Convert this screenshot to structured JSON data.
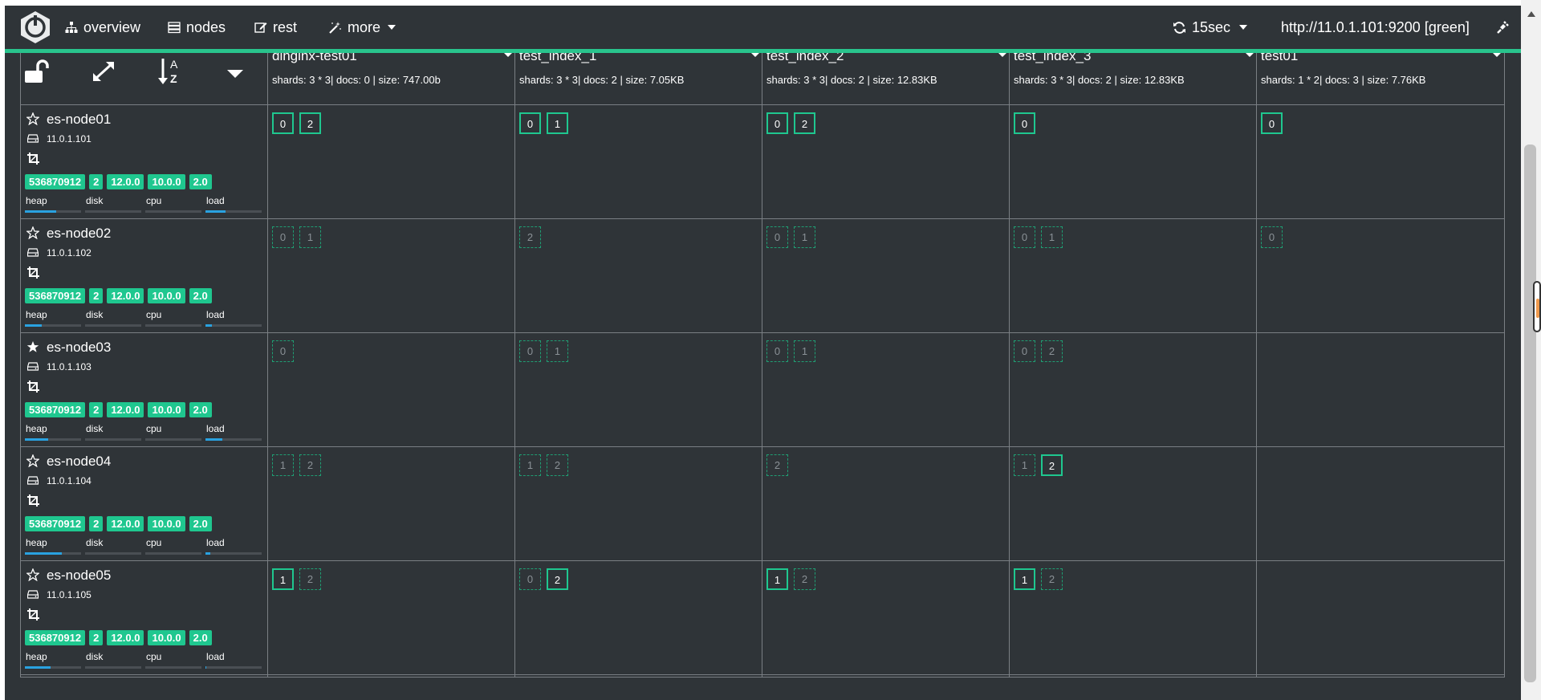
{
  "navbar": {
    "overview_label": "overview",
    "nodes_label": "nodes",
    "rest_label": "rest",
    "more_label": "more",
    "refresh_label": "15sec",
    "cluster_label": "http://11.0.1.101:9200 [green]"
  },
  "colors": {
    "accent": "#29c48d",
    "background": "#2f3438",
    "badge": "#1fc78f",
    "metric_fill": "#29a2e0"
  },
  "controls": [
    "unlock-icon",
    "expand-icon",
    "sort-alpha-icon",
    "caret-down-icon"
  ],
  "indices": [
    {
      "name": "dinginx-test01",
      "stats": "shards: 3 * 3| docs: 0 | size: 747.00b"
    },
    {
      "name": "test_index_1",
      "stats": "shards: 3 * 3| docs: 2 | size: 7.05KB"
    },
    {
      "name": "test_index_2",
      "stats": "shards: 3 * 3| docs: 2 | size: 12.83KB"
    },
    {
      "name": "test_index_3",
      "stats": "shards: 3 * 3| docs: 2 | size: 12.83KB"
    },
    {
      "name": "test01",
      "stats": "shards: 1 * 2| docs: 3 | size: 7.76KB"
    }
  ],
  "nodes": [
    {
      "name": "es-node01",
      "ip": "11.0.1.101",
      "master": false,
      "badges": [
        "536870912",
        "2",
        "12.0.0",
        "10.0.0",
        "2.0"
      ],
      "metrics": {
        "heap": 0.55,
        "disk": 0.0,
        "cpu": 0.0,
        "load": 0.35
      },
      "shards": [
        [
          {
            "n": "0",
            "p": true
          },
          {
            "n": "2",
            "p": true
          }
        ],
        [
          {
            "n": "0",
            "p": true
          },
          {
            "n": "1",
            "p": true
          }
        ],
        [
          {
            "n": "0",
            "p": true
          },
          {
            "n": "2",
            "p": true
          }
        ],
        [
          {
            "n": "0",
            "p": true
          }
        ],
        [
          {
            "n": "0",
            "p": true
          }
        ]
      ]
    },
    {
      "name": "es-node02",
      "ip": "11.0.1.102",
      "master": false,
      "badges": [
        "536870912",
        "2",
        "12.0.0",
        "10.0.0",
        "2.0"
      ],
      "metrics": {
        "heap": 0.3,
        "disk": 0.0,
        "cpu": 0.0,
        "load": 0.12
      },
      "shards": [
        [
          {
            "n": "0",
            "p": false
          },
          {
            "n": "1",
            "p": false
          }
        ],
        [
          {
            "n": "2",
            "p": false
          }
        ],
        [
          {
            "n": "0",
            "p": false
          },
          {
            "n": "1",
            "p": false
          }
        ],
        [
          {
            "n": "0",
            "p": false
          },
          {
            "n": "1",
            "p": false
          }
        ],
        [
          {
            "n": "0",
            "p": false
          }
        ]
      ]
    },
    {
      "name": "es-node03",
      "ip": "11.0.1.103",
      "master": true,
      "badges": [
        "536870912",
        "2",
        "12.0.0",
        "10.0.0",
        "2.0"
      ],
      "metrics": {
        "heap": 0.42,
        "disk": 0.0,
        "cpu": 0.0,
        "load": 0.3
      },
      "shards": [
        [
          {
            "n": "0",
            "p": false
          }
        ],
        [
          {
            "n": "0",
            "p": false
          },
          {
            "n": "1",
            "p": false
          }
        ],
        [
          {
            "n": "0",
            "p": false
          },
          {
            "n": "1",
            "p": false
          }
        ],
        [
          {
            "n": "0",
            "p": false
          },
          {
            "n": "2",
            "p": false
          }
        ],
        []
      ]
    },
    {
      "name": "es-node04",
      "ip": "11.0.1.104",
      "master": false,
      "badges": [
        "536870912",
        "2",
        "12.0.0",
        "10.0.0",
        "2.0"
      ],
      "metrics": {
        "heap": 0.65,
        "disk": 0.0,
        "cpu": 0.0,
        "load": 0.08
      },
      "shards": [
        [
          {
            "n": "1",
            "p": false
          },
          {
            "n": "2",
            "p": false
          }
        ],
        [
          {
            "n": "1",
            "p": false
          },
          {
            "n": "2",
            "p": false
          }
        ],
        [
          {
            "n": "2",
            "p": false
          }
        ],
        [
          {
            "n": "1",
            "p": false
          },
          {
            "n": "2",
            "p": true
          }
        ],
        []
      ]
    },
    {
      "name": "es-node05",
      "ip": "11.0.1.105",
      "master": false,
      "badges": [
        "536870912",
        "2",
        "12.0.0",
        "10.0.0",
        "2.0"
      ],
      "metrics": {
        "heap": 0.45,
        "disk": 0.0,
        "cpu": 0.0,
        "load": 0.02
      },
      "shards": [
        [
          {
            "n": "1",
            "p": true
          },
          {
            "n": "2",
            "p": false
          }
        ],
        [
          {
            "n": "0",
            "p": false
          },
          {
            "n": "2",
            "p": true
          }
        ],
        [
          {
            "n": "1",
            "p": true
          },
          {
            "n": "2",
            "p": false
          }
        ],
        [
          {
            "n": "1",
            "p": true
          },
          {
            "n": "2",
            "p": false
          }
        ],
        []
      ]
    }
  ],
  "metric_labels": [
    "heap",
    "disk",
    "cpu",
    "load"
  ]
}
